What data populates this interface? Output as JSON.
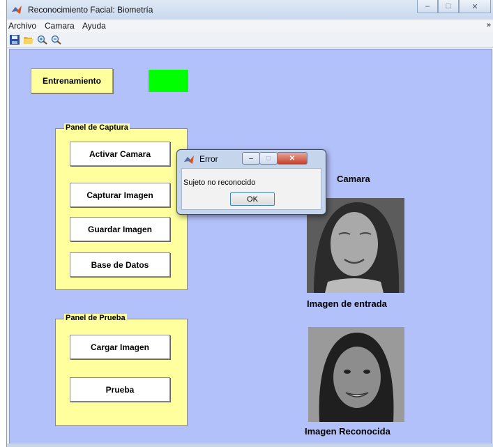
{
  "window": {
    "title": "Reconocimiento Facial: Biometría"
  },
  "menu": {
    "items": [
      "Archivo",
      "Camara",
      "Ayuda"
    ],
    "overflow_icon": "double-arrow-icon"
  },
  "toolbar": {
    "icons": [
      "save-icon",
      "open-folder-icon",
      "zoom-in-icon",
      "zoom-out-icon"
    ]
  },
  "main": {
    "train_button": "Entrenamiento",
    "status_color": "#00ff00",
    "capture_panel": {
      "title": "Panel de Captura",
      "buttons": [
        "Activar Camara",
        "Capturar Imagen",
        "Guardar  Imagen",
        "Base de Datos"
      ]
    },
    "test_panel": {
      "title": "Panel de Prueba",
      "buttons": [
        "Cargar Imagen",
        "Prueba"
      ]
    },
    "camera_label": "Camara",
    "input_label": "Imagen de entrada",
    "recognized_label": "Imagen Reconocida"
  },
  "dialog": {
    "title": "Error",
    "message": "Sujeto no reconocido",
    "ok_label": "OK"
  },
  "colors": {
    "figure_bg": "#b3c1fa",
    "panel_bg": "#ffff9e",
    "status": "#00ff00"
  }
}
